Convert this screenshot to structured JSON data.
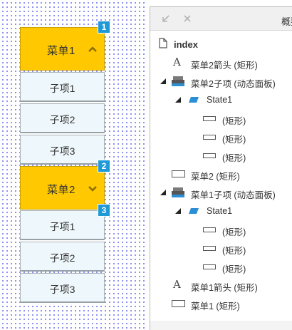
{
  "canvas": {
    "menu2": {
      "header_label": "菜单1",
      "header_badge": "1",
      "items": [
        "子项1",
        "子项2",
        "子项3"
      ]
    },
    "menu1": {
      "header_label": "菜单2",
      "header_badge": "2",
      "items_badge": "3",
      "items": [
        "子项1",
        "子项2",
        "子项3"
      ]
    },
    "colors": {
      "header_fill": "#ffc800",
      "item_fill": "#eef7fb",
      "badge": "#1f9ad6",
      "grid_dot": "#6f73f0"
    }
  },
  "outline": {
    "title": "概要",
    "buttons": [
      "collapse-icon",
      "close-icon"
    ],
    "rows": [
      {
        "label": "index",
        "icon": "page-icon"
      },
      {
        "label": "菜单2箭头 (矩形)",
        "icon": "text-icon"
      },
      {
        "label": "菜单2子项 (动态面板)",
        "icon": "dynamic-panel-icon"
      },
      {
        "label": "State1",
        "icon": "state-icon"
      },
      {
        "label": "(矩形)",
        "icon": "rectangle-icon"
      },
      {
        "label": "(矩形)",
        "icon": "rectangle-icon"
      },
      {
        "label": "(矩形)",
        "icon": "rectangle-icon"
      },
      {
        "label": "菜单2 (矩形)",
        "icon": "rectangle-icon"
      },
      {
        "label": "菜单1子项 (动态面板)",
        "icon": "dynamic-panel-icon"
      },
      {
        "label": "State1",
        "icon": "state-icon"
      },
      {
        "label": "(矩形)",
        "icon": "rectangle-icon"
      },
      {
        "label": "(矩形)",
        "icon": "rectangle-icon"
      },
      {
        "label": "(矩形)",
        "icon": "rectangle-icon"
      },
      {
        "label": "菜单1箭头 (矩形)",
        "icon": "text-icon"
      },
      {
        "label": "菜单1 (矩形)",
        "icon": "rectangle-icon"
      }
    ]
  }
}
